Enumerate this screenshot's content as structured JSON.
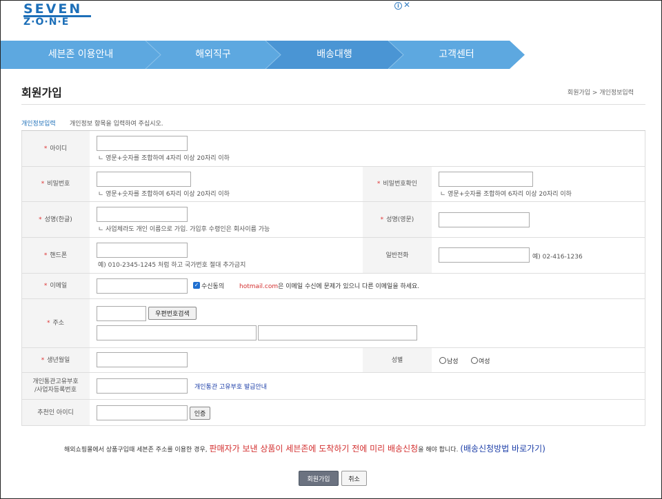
{
  "logo": {
    "line1": "SEVEN",
    "line2": "Z·O·N·E"
  },
  "ad": {
    "info_icon": "info-icon",
    "close_icon": "close-icon",
    "info_glyph": "i",
    "close_glyph": "✕"
  },
  "nav": {
    "items": [
      "세븐존 이용안내",
      "해외직구",
      "배송대행",
      "고객센터"
    ],
    "colors": [
      "#5da8e0",
      "#4a95d4"
    ]
  },
  "page": {
    "title": "회원가입",
    "breadcrumb": "회원가입 > 개인정보입력"
  },
  "section": {
    "label": "개인정보입력",
    "desc": "개인정보 항목을 입력하여 주십시오."
  },
  "form": {
    "required_mark": "*",
    "id": {
      "label": "아이디",
      "hint": "ㄴ 영문+숫자를 조합하여 4자리 이상 20자리 이하"
    },
    "password": {
      "label": "비밀번호",
      "hint": "ㄴ 영문+숫자를 조합하여 6자리 이상 20자리 이하"
    },
    "password_confirm": {
      "label": "비밀번호확인",
      "hint": "ㄴ 영문+숫자를 조합하여 6자리 이상 20자리 이하"
    },
    "name_kr": {
      "label": "성명(한글)",
      "hint": "ㄴ 사업체라도 개인 이름으로 가입. 가입후 수령인은 회사이름 가능"
    },
    "name_en": {
      "label": "성명(영문)"
    },
    "mobile": {
      "label": "핸드폰",
      "hint": "예) 010-2345-1245 처럼 하고 국가번호 절대 추가금지"
    },
    "phone": {
      "label": "일반전화",
      "hint": "예) 02-416-1236"
    },
    "email": {
      "label": "이메일",
      "consent": "수신동의",
      "warn_domain": "hotmail.com",
      "warn_text": "은 이메일 수신에 문제가 있으니 다른 이메일을 하세요."
    },
    "address": {
      "label": "주소",
      "search_button": "우편번호검색"
    },
    "birth": {
      "label": "생년월일"
    },
    "gender": {
      "label": "성별",
      "male": "남성",
      "female": "여성"
    },
    "customs": {
      "label_1": "개인통관고유부호",
      "label_2": "/사업자등록번호",
      "link": "개인통관 고유부호 발급안내"
    },
    "referrer": {
      "label": "추천인 아이디",
      "verify_button": "인증"
    }
  },
  "notice": {
    "pre": "해외쇼핑몰에서 상품구입때 세븐존 주소를 이용한 경우, ",
    "red": "판매자가 보낸 상품이 세븐존에 도착하기 전에 미리 배송신청",
    "mid": "을 해야 합니다. ",
    "link": "(배송신청방법 바로가기)"
  },
  "buttons": {
    "join": "회원가입",
    "cancel": "취소"
  }
}
